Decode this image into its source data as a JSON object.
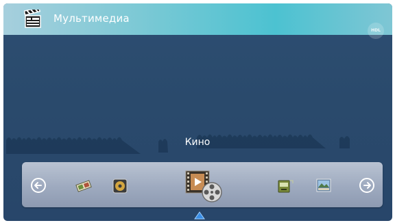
{
  "header": {
    "title": "Мультимедиа",
    "app_icon": "clapperboard-icon",
    "brand_logo": "HDL"
  },
  "section": {
    "label": "Кино"
  },
  "dock": {
    "items": [
      {
        "name": "arrow-left-icon"
      },
      {
        "name": "photo-slides-icon"
      },
      {
        "name": "music-player-icon"
      },
      {
        "name": "movie-film-reel-icon",
        "selected": true
      },
      {
        "name": "storage-drive-icon"
      },
      {
        "name": "picture-gallery-icon"
      },
      {
        "name": "arrow-right-icon"
      }
    ]
  },
  "colors": {
    "background": "#2b4b6e",
    "topbar_accent": "#4cc2d1",
    "dock": "#a3aec2",
    "indicator": "#3a8ee6"
  }
}
